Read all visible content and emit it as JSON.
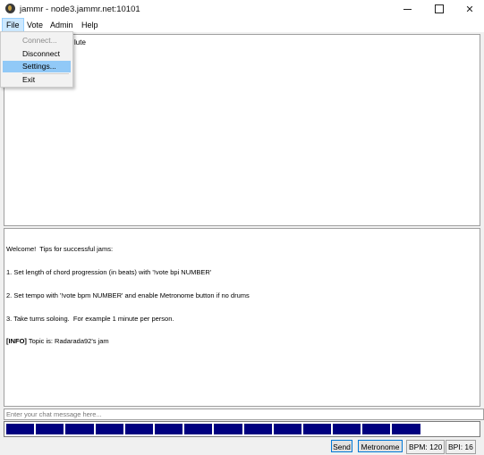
{
  "window": {
    "title": "jammr - node3.jammr.net:10101",
    "min_glyph": "",
    "close_glyph": "✕"
  },
  "menubar": {
    "items": [
      "File",
      "Vote",
      "Admin",
      "Help"
    ]
  },
  "file_menu": {
    "items": [
      {
        "label": "Connect...",
        "enabled": false
      },
      {
        "label": "Disconnect",
        "enabled": true
      },
      {
        "label": "Settings...",
        "enabled": true,
        "highlighted": true
      },
      {
        "label": "Exit",
        "enabled": true
      }
    ]
  },
  "users_pane": {
    "partial_text": "lute"
  },
  "chat": {
    "lines": [
      "Welcome!  Tips for successful jams:",
      "1. Set length of chord progression (in beats) with '!vote bpi NUMBER'",
      "2. Set tempo with '!vote bpm NUMBER' and enable Metronome button if no drums",
      "3. Take turns soloing.  For example 1 minute per person."
    ],
    "info_tag": "[INFO]",
    "info_text": " Topic is: Radarada92's jam",
    "input_placeholder": "Enter your chat message here..."
  },
  "beat_bar": {
    "total_beats": 16,
    "filled_beats": 14,
    "fill_color": "#00007f"
  },
  "status": {
    "send_label": "Send",
    "metronome_label": "Metronome",
    "bpm_label": "BPM: 120",
    "bpi_label": "BPI: 16"
  }
}
